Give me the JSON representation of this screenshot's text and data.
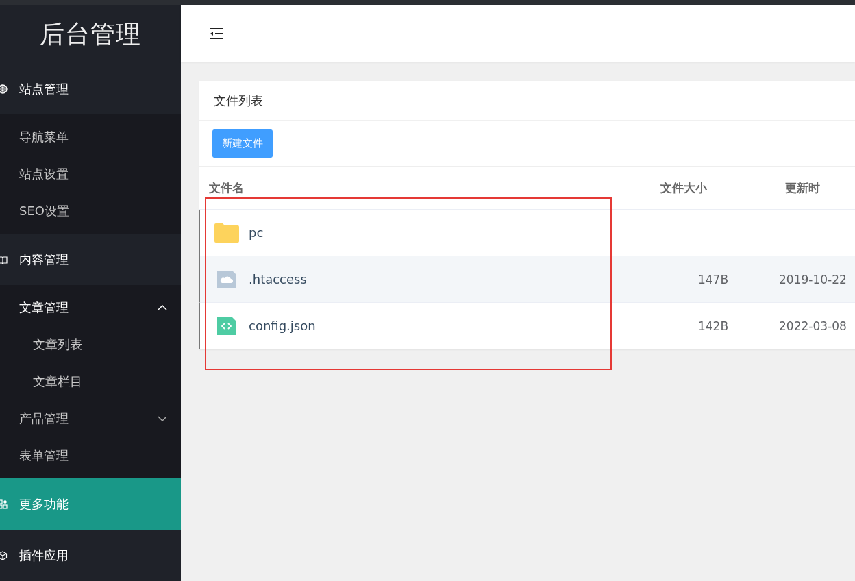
{
  "sidebar": {
    "logo": "后台管理",
    "groups": [
      {
        "label": "站点管理",
        "selected": false,
        "children": [
          {
            "label": "导航菜单"
          },
          {
            "label": "站点设置"
          },
          {
            "label": "SEO设置"
          }
        ]
      },
      {
        "label": "内容管理",
        "selected": false,
        "children": [
          {
            "label": "文章管理",
            "expanded": true,
            "children": [
              {
                "label": "文章列表"
              },
              {
                "label": "文章栏目"
              }
            ]
          },
          {
            "label": "产品管理",
            "expanded": false
          },
          {
            "label": "表单管理"
          }
        ]
      },
      {
        "label": "更多功能",
        "selected": true
      },
      {
        "label": "插件应用",
        "selected": false
      }
    ]
  },
  "card": {
    "title": "文件列表",
    "new_button": "新建文件",
    "table": {
      "columns": [
        "文件名",
        "文件大小",
        "更新时"
      ],
      "rows": [
        {
          "kind": "folder",
          "name": "pc",
          "size": "",
          "date": "",
          "hovered": false
        },
        {
          "kind": "file",
          "name": ".htaccess",
          "size": "147B",
          "date": "2019-10-22",
          "hovered": true
        },
        {
          "kind": "code",
          "name": "config.json",
          "size": "142B",
          "date": "2022-03-08",
          "hovered": false
        }
      ]
    }
  }
}
